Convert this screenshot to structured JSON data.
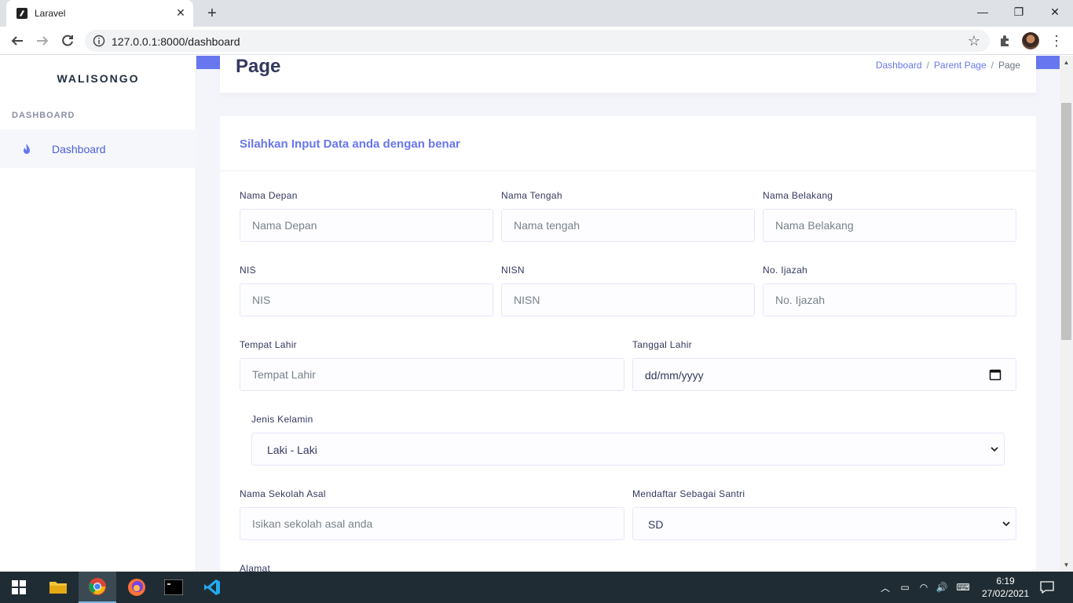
{
  "browser": {
    "tab_title": "Laravel",
    "url": "127.0.0.1:8000/dashboard",
    "tab_close": "✕",
    "new_tab": "+",
    "min": "—",
    "max": "❐",
    "close": "✕"
  },
  "sidebar": {
    "brand": "WALISONGO",
    "heading": "DASHBOARD",
    "items": [
      {
        "label": "Dashboard",
        "icon": "fire-icon"
      }
    ]
  },
  "header": {
    "title": "Page",
    "breadcrumb": [
      "Dashboard",
      "Parent Page",
      "Page"
    ]
  },
  "form": {
    "title": "Silahkan Input Data anda dengan benar",
    "nama_depan": {
      "label": "Nama Depan",
      "placeholder": "Nama Depan"
    },
    "nama_tengah": {
      "label": "Nama Tengah",
      "placeholder": "Nama tengah"
    },
    "nama_belakang": {
      "label": "Nama Belakang",
      "placeholder": "Nama Belakang"
    },
    "nis": {
      "label": "NIS",
      "placeholder": "NIS"
    },
    "nisn": {
      "label": "NISN",
      "placeholder": "NISN"
    },
    "ijazah": {
      "label": "No. Ijazah",
      "placeholder": "No. Ijazah"
    },
    "tempat_lahir": {
      "label": "Tempat Lahir",
      "placeholder": "Tempat Lahir"
    },
    "tanggal_lahir": {
      "label": "Tanggal Lahir",
      "placeholder": "dd/mm/yyyy"
    },
    "jenis_kelamin": {
      "label": "Jenis Kelamin",
      "value": "Laki - Laki"
    },
    "sekolah_asal": {
      "label": "Nama Sekolah Asal",
      "placeholder": "Isikan sekolah asal anda"
    },
    "mendaftar": {
      "label": "Mendaftar Sebagai Santri",
      "value": "SD"
    },
    "alamat": {
      "label": "Alamat"
    }
  },
  "taskbar": {
    "time": "6:19",
    "date": "27/02/2021"
  },
  "colors": {
    "accent": "#6777ef",
    "title": "#34395e"
  }
}
